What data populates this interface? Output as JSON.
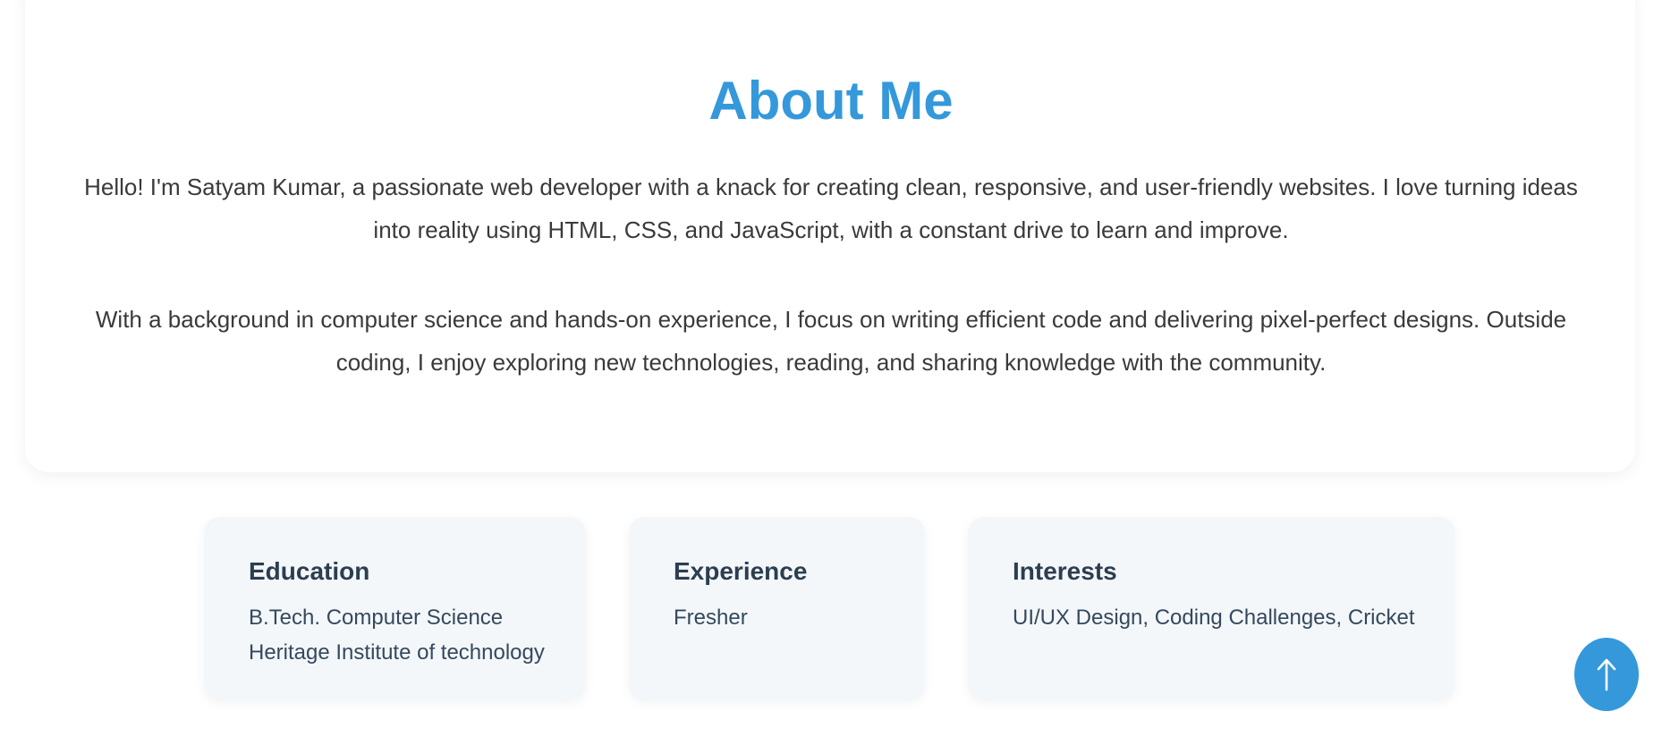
{
  "about": {
    "title": "About Me",
    "paragraphs": [
      "Hello! I'm Satyam Kumar, a passionate web developer with a knack for creating clean, responsive, and user-friendly websites. I love turning ideas into reality using HTML, CSS, and JavaScript, with a constant drive to learn and improve.",
      "With a background in computer science and hands-on experience, I focus on writing efficient code and delivering pixel-perfect designs. Outside coding, I enjoy exploring new technologies, reading, and sharing knowledge with the community."
    ]
  },
  "cards": {
    "education": {
      "title": "Education",
      "lines": [
        "B.Tech. Computer Science",
        "Heritage Institute of technology"
      ]
    },
    "experience": {
      "title": "Experience",
      "lines": [
        "Fresher"
      ]
    },
    "interests": {
      "title": "Interests",
      "lines": [
        "UI/UX Design, Coding Challenges, Cricket"
      ]
    }
  },
  "scroll_top": {
    "icon": "arrow-up-icon"
  },
  "colors": {
    "accent": "#3498db",
    "card_background": "#f4f7fa",
    "heading_text": "#2c3e50",
    "body_text": "#3a3a3a"
  }
}
